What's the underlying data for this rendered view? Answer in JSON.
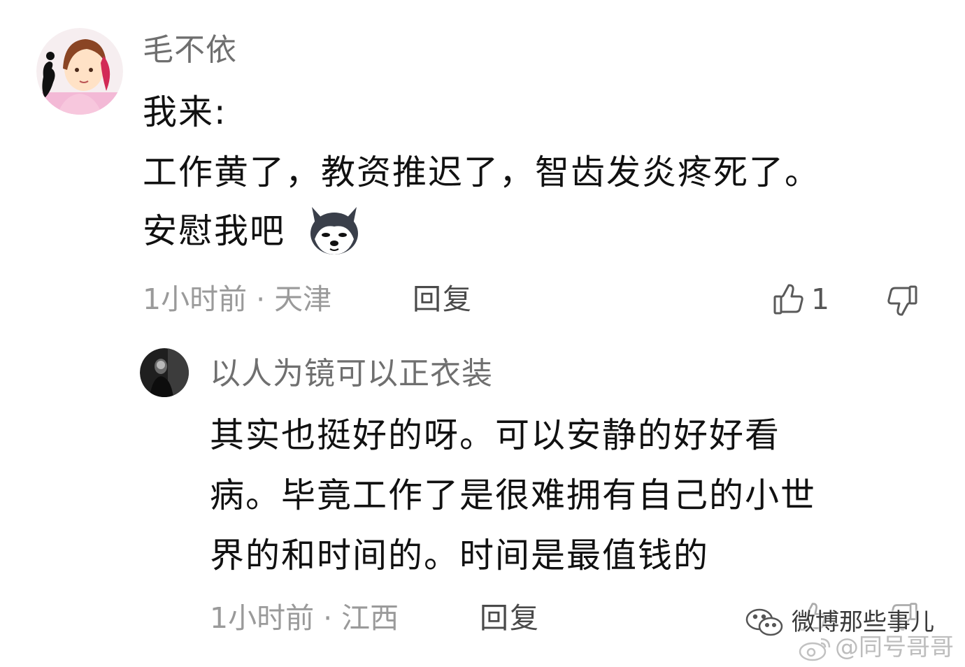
{
  "comments": [
    {
      "username": "毛不依",
      "lines": [
        "我来:",
        "工作黄了，教资推迟了，智齿发炎疼死了。",
        "安慰我吧"
      ],
      "emoji": "dog-face-emoji",
      "meta": "1小时前 · 天津",
      "reply_label": "回复",
      "like_count": "1"
    },
    {
      "username": "以人为镜可以正衣装",
      "lines": [
        "其实也挺好的呀。可以安静的好好看",
        "病。毕竟工作了是很难拥有自己的小世",
        "界的和时间的。时间是最值钱的"
      ],
      "meta": "1小时前 · 江西",
      "reply_label": "回复"
    }
  ],
  "watermarks": {
    "account": "微博那些事儿",
    "handle": "@同号哥哥"
  },
  "icons": {
    "like": "thumbs-up-icon",
    "dislike": "thumbs-down-icon"
  }
}
